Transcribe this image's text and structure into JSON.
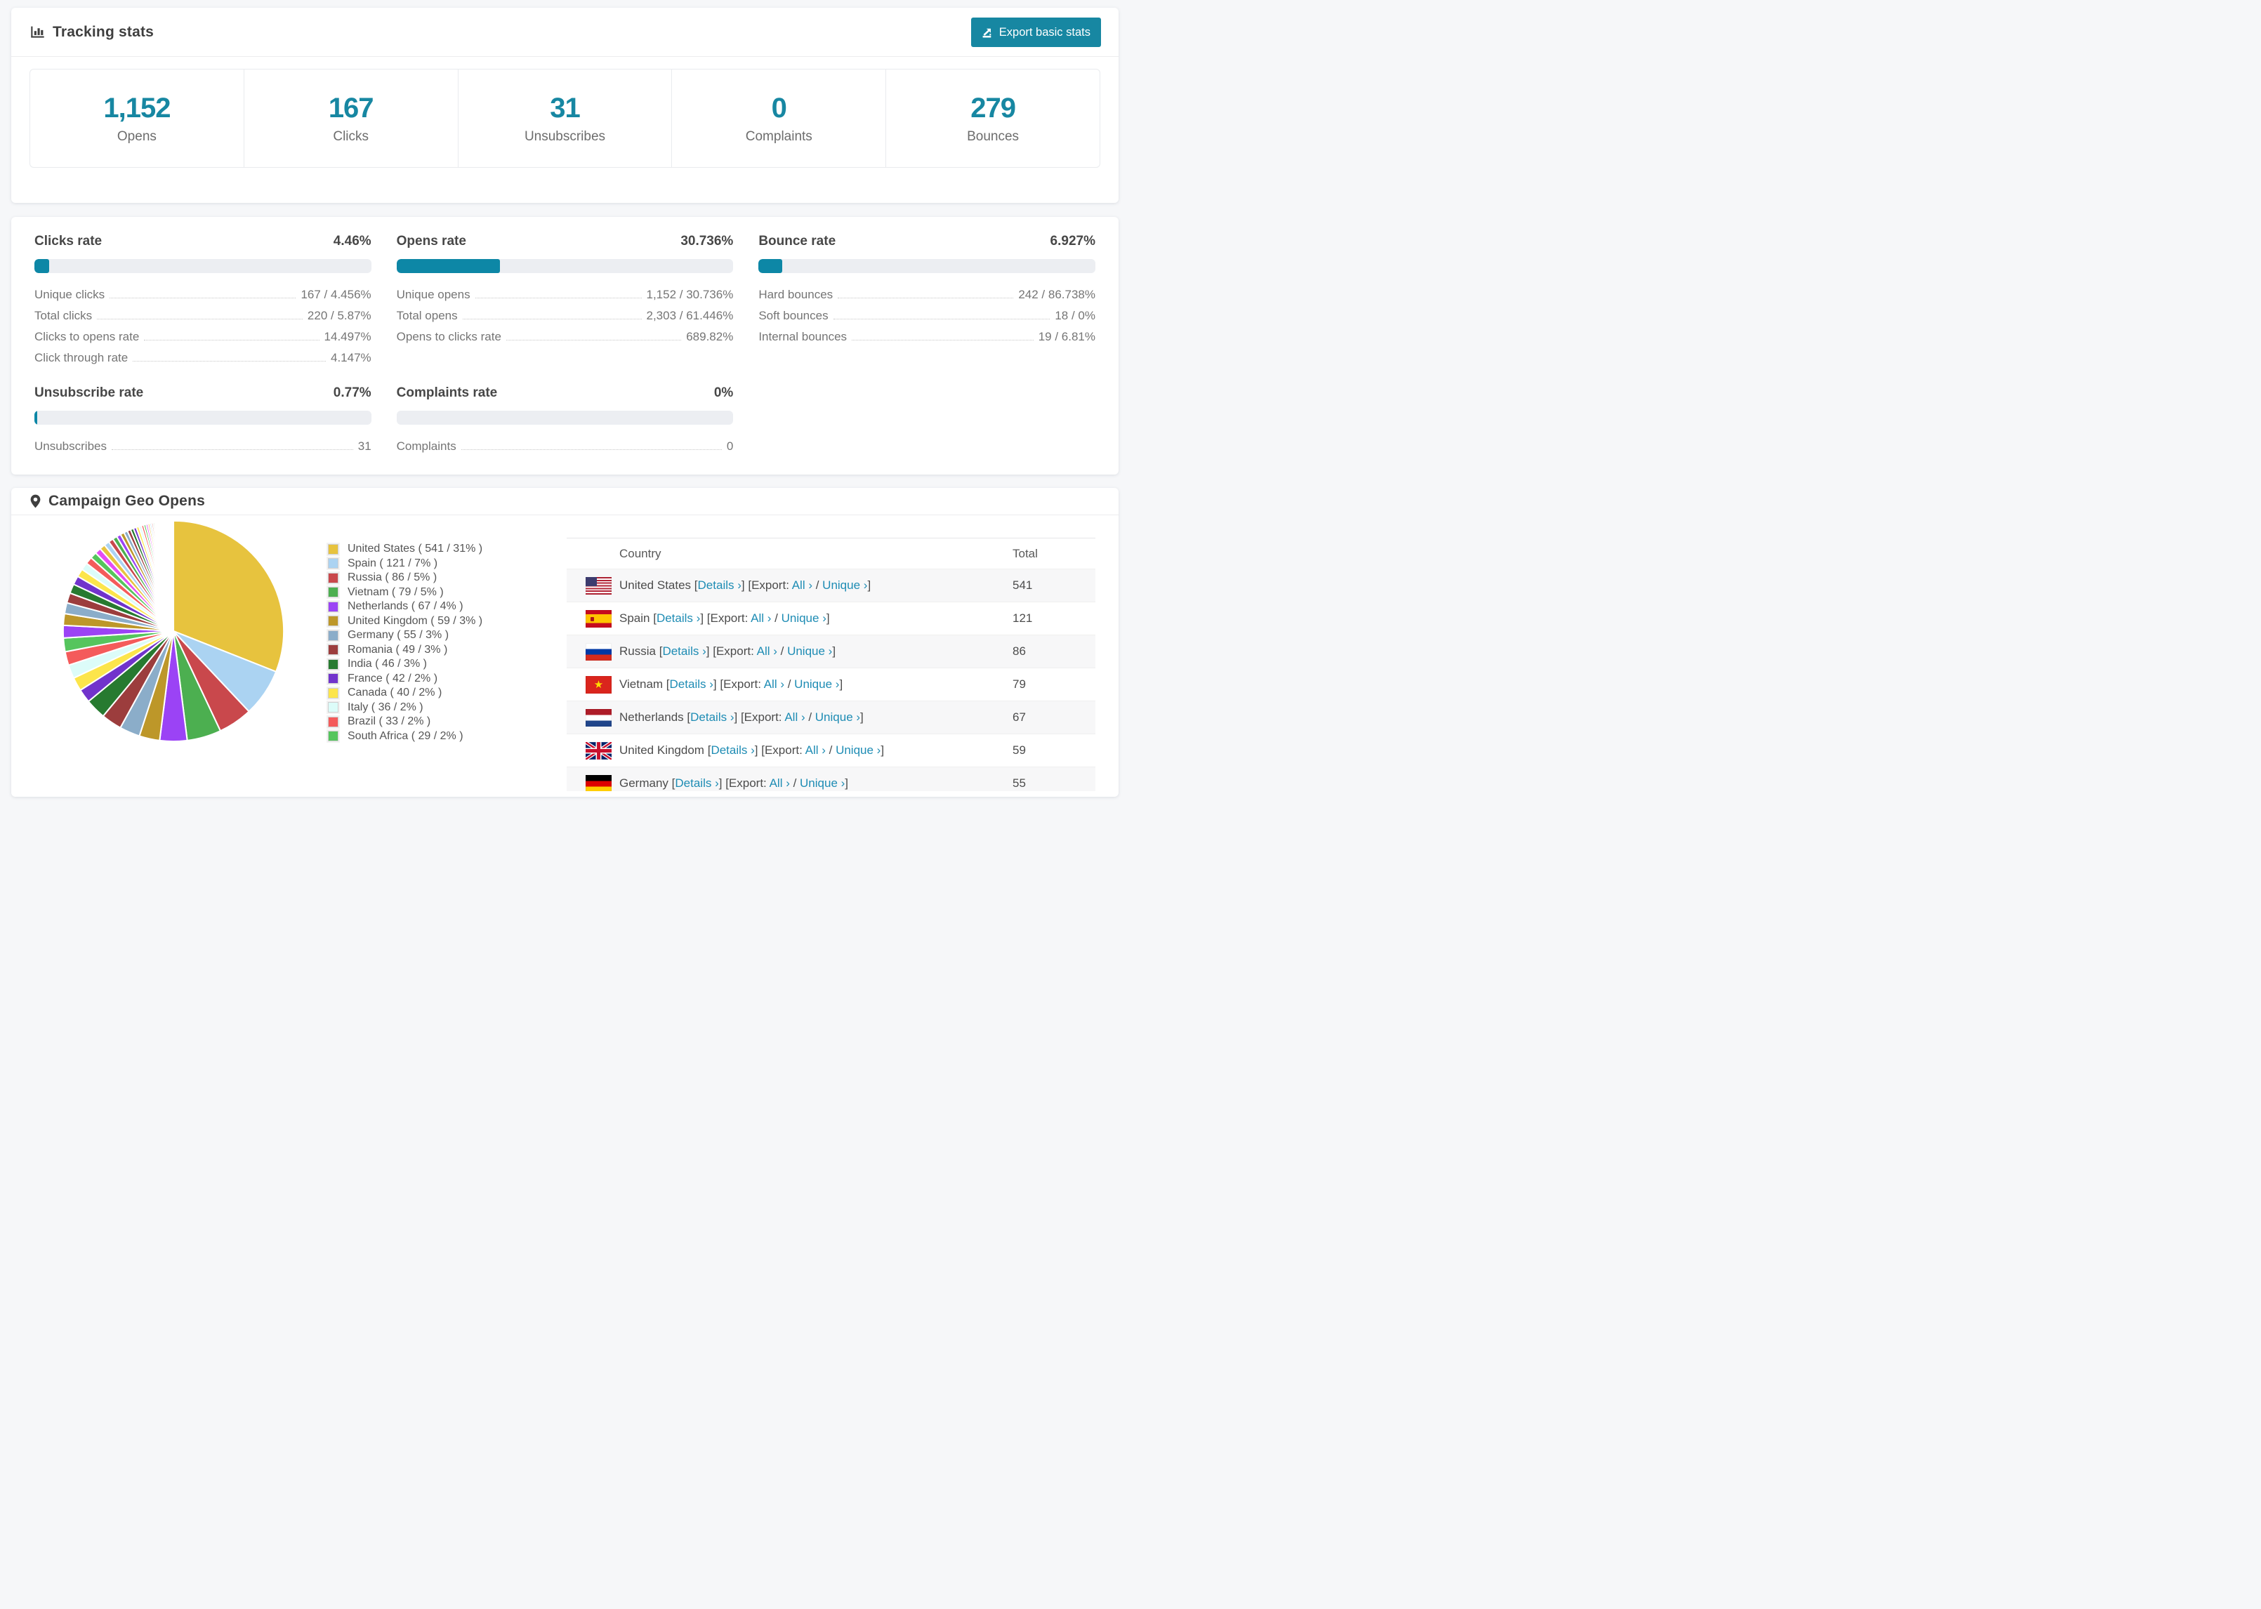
{
  "colors": {
    "accent_teal": "#1787a2",
    "bar_fill": "#0d87a6",
    "bar_track": "#eceef2",
    "link_teal": "#1e8cb4",
    "row_alt_bg": "#f7f7f8"
  },
  "tracking_stats": {
    "title": "Tracking stats",
    "export_button": "Export basic stats",
    "summary": [
      {
        "value": "1,152",
        "label": "Opens"
      },
      {
        "value": "167",
        "label": "Clicks"
      },
      {
        "value": "31",
        "label": "Unsubscribes"
      },
      {
        "value": "0",
        "label": "Complaints"
      },
      {
        "value": "279",
        "label": "Bounces"
      }
    ]
  },
  "rates": [
    {
      "title": "Clicks rate",
      "value": "4.46%",
      "pct": 4.46,
      "rows": [
        {
          "label": "Unique clicks",
          "value": "167 / 4.456%"
        },
        {
          "label": "Total clicks",
          "value": "220 / 5.87%"
        },
        {
          "label": "Clicks to opens rate",
          "value": "14.497%"
        },
        {
          "label": "Click through rate",
          "value": "4.147%"
        }
      ]
    },
    {
      "title": "Opens rate",
      "value": "30.736%",
      "pct": 30.736,
      "rows": [
        {
          "label": "Unique opens",
          "value": "1,152 / 30.736%"
        },
        {
          "label": "Total opens",
          "value": "2,303 / 61.446%"
        },
        {
          "label": "Opens to clicks rate",
          "value": "689.82%"
        }
      ]
    },
    {
      "title": "Bounce rate",
      "value": "6.927%",
      "pct": 6.927,
      "rows": [
        {
          "label": "Hard bounces",
          "value": "242 / 86.738%"
        },
        {
          "label": "Soft bounces",
          "value": "18 / 0%"
        },
        {
          "label": "Internal bounces",
          "value": "19 / 6.81%"
        }
      ]
    },
    {
      "title": "Unsubscribe rate",
      "value": "0.77%",
      "pct": 0.77,
      "rows": [
        {
          "label": "Unsubscribes",
          "value": "31"
        }
      ]
    },
    {
      "title": "Complaints rate",
      "value": "0%",
      "pct": 0,
      "rows": [
        {
          "label": "Complaints",
          "value": "0"
        }
      ]
    }
  ],
  "geo": {
    "title": "Campaign Geo Opens",
    "table": {
      "columns": [
        "Country",
        "Total"
      ],
      "tokens": {
        "bracket_open": "[",
        "bracket_close": "]",
        "details": "Details ›",
        "export": "Export:",
        "all": "All ›",
        "slash": "/",
        "unique": "Unique ›"
      },
      "rows": [
        {
          "country": "United States",
          "flag": "us",
          "total": "541"
        },
        {
          "country": "Spain",
          "flag": "es",
          "total": "121"
        },
        {
          "country": "Russia",
          "flag": "ru",
          "total": "86"
        },
        {
          "country": "Vietnam",
          "flag": "vn",
          "total": "79"
        },
        {
          "country": "Netherlands",
          "flag": "nl",
          "total": "67"
        },
        {
          "country": "United Kingdom",
          "flag": "gb",
          "total": "59"
        },
        {
          "country": "Germany",
          "flag": "de",
          "total": "55"
        }
      ]
    }
  },
  "chart_data": {
    "type": "pie",
    "title": "Campaign Geo Opens",
    "unit": "opens",
    "legend_position": "right",
    "start_angle_deg": 0,
    "direction": "clockwise",
    "slices": [
      {
        "label": "United States",
        "value": 541,
        "pct": 31,
        "color": "#e7c33e"
      },
      {
        "label": "Spain",
        "value": 121,
        "pct": 7,
        "color": "#abd3f2"
      },
      {
        "label": "Russia",
        "value": 86,
        "pct": 5,
        "color": "#c9484c"
      },
      {
        "label": "Vietnam",
        "value": 79,
        "pct": 5,
        "color": "#4caf50"
      },
      {
        "label": "Netherlands",
        "value": 67,
        "pct": 4,
        "color": "#9b43f5"
      },
      {
        "label": "United Kingdom",
        "value": 59,
        "pct": 3,
        "color": "#bd9729"
      },
      {
        "label": "Germany",
        "value": 55,
        "pct": 3,
        "color": "#8badc9"
      },
      {
        "label": "Romania",
        "value": 49,
        "pct": 3,
        "color": "#9c3d3d"
      },
      {
        "label": "India",
        "value": 46,
        "pct": 3,
        "color": "#277a30"
      },
      {
        "label": "France",
        "value": 42,
        "pct": 2,
        "color": "#7133cc"
      },
      {
        "label": "Canada",
        "value": 40,
        "pct": 2,
        "color": "#fce54b"
      },
      {
        "label": "Italy",
        "value": 36,
        "pct": 2,
        "color": "#dcfcf9"
      },
      {
        "label": "Brazil",
        "value": 33,
        "pct": 2,
        "color": "#f45b5b"
      },
      {
        "label": "South Africa",
        "value": 29,
        "pct": 2,
        "color": "#55c55d"
      }
    ],
    "other_small_slices_total_pct": 26
  }
}
